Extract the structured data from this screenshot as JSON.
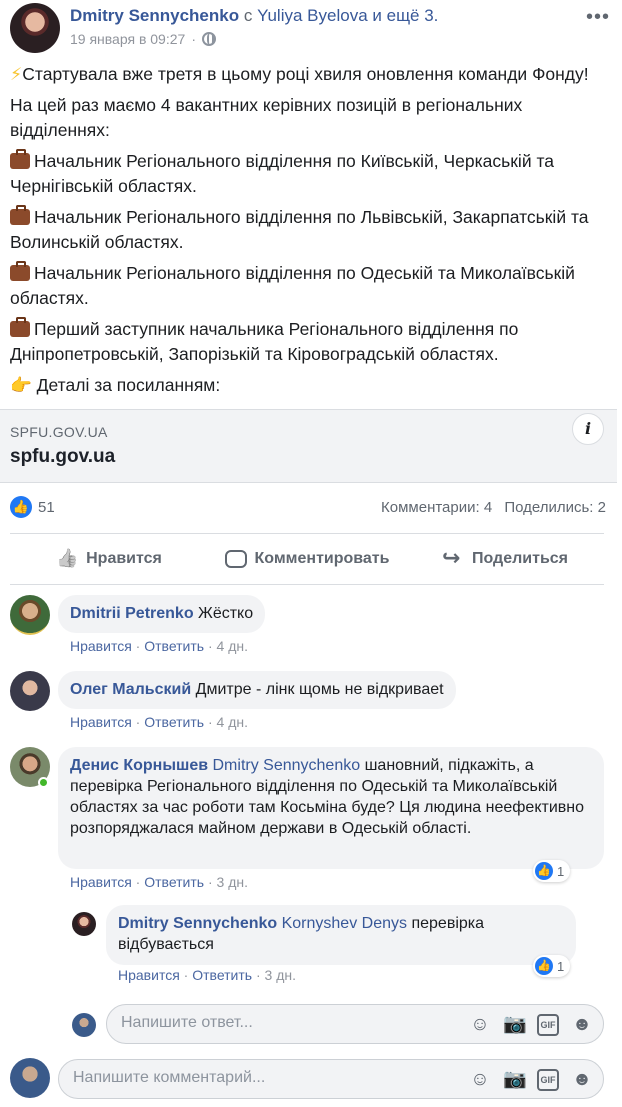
{
  "post": {
    "author": "Dmitry Sennychenko",
    "with_word": "с",
    "tagged": "Yuliya Byelova",
    "others": "и ещё 3.",
    "time": "19 января в 09:27",
    "paragraphs": [
      "Стартувала вже третя в цьому році хвиля оновлення команди Фонду!",
      "На цей раз маємо 4 вакантних керівних позицій в регіональних відділеннях:",
      "Начальник Регіонального відділення по Київській, Черкаській та Чернігівській областях.",
      "Начальник Регіонального відділення по Львівській, Закарпатській та Волинській областях.",
      "Начальник Регіонального відділення по Одеській та Миколаївській областях.",
      "Перший заступник начальника Регіонального відділення по Дніпропетровській, Запорізькій та Кіровоградській областях.",
      "Деталі за посиланням:"
    ],
    "link": {
      "domain": "SPFU.GOV.UA",
      "title": "spfu.gov.ua"
    }
  },
  "stats": {
    "likes": "51",
    "comments": "Комментарии: 4",
    "shares": "Поделились: 2"
  },
  "actions": {
    "like": "Нравится",
    "comment": "Комментировать",
    "share": "Поделиться"
  },
  "comments": [
    {
      "name": "Dmitrii Petrenko",
      "text": "Жёстко",
      "like": "Нравится",
      "reply": "Ответить",
      "time": "4 дн."
    },
    {
      "name": "Олег Мальский",
      "text": "Дмитре - лінк щомь не відкриваеt",
      "like": "Нравится",
      "reply": "Ответить",
      "time": "4 дн."
    },
    {
      "name": "Денис Корнышев",
      "tag": "Dmitry Sennychenko",
      "text": "шановний, підкажіть, а перевірка Регіонального відділення по Одеській та Миколаївській областях за час роботи там Косьміна буде? Ця людина неефективно розпоряджалася майном держави в Одеській області.",
      "like": "Нравится",
      "reply": "Ответить",
      "time": "3 дн.",
      "reactions": "1"
    }
  ],
  "reply": {
    "name": "Dmitry Sennychenko",
    "tag": "Kornyshev Denys",
    "text": "перевірка відбувається",
    "like": "Нравится",
    "reply_label": "Ответить",
    "time": "3 дн.",
    "reactions": "1"
  },
  "reply_composer": {
    "placeholder": "Напишите ответ..."
  },
  "comment_composer": {
    "placeholder": "Напишите комментарий..."
  },
  "icons": [
    "more-icon",
    "globe-icon",
    "info-icon",
    "like-icon",
    "comment-icon",
    "share-icon",
    "emoji-icon",
    "camera-icon",
    "gif-icon",
    "sticker-icon"
  ],
  "colors": {
    "link_blue": "#385898",
    "like_blue": "#2078f4",
    "meta_gray": "#90949c",
    "bubble_bg": "#f2f3f5"
  }
}
